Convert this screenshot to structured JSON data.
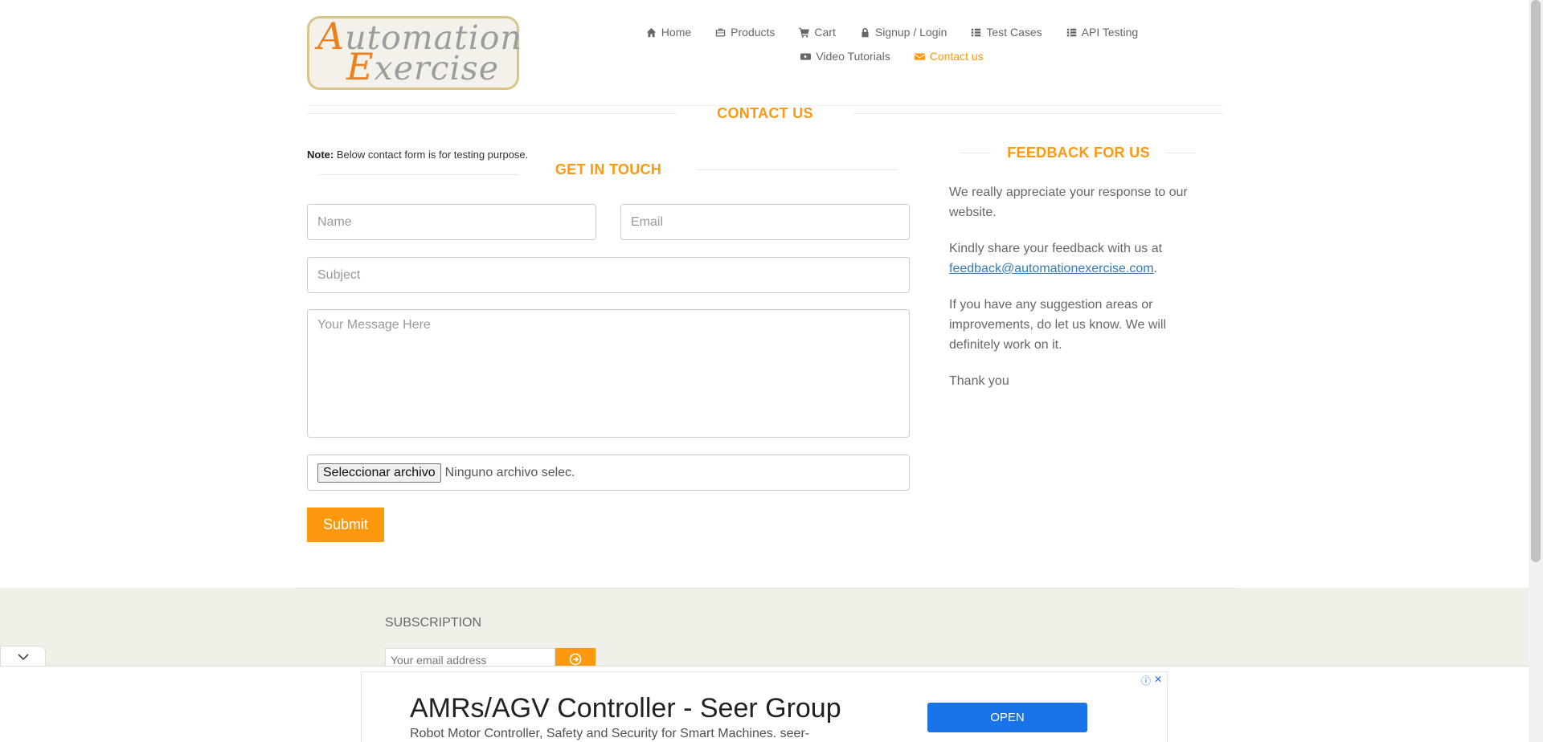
{
  "logo": {
    "line1_cap": "A",
    "line1_rest": "utomation",
    "line2_cap": "E",
    "line2_rest": "xercise"
  },
  "nav": {
    "row1": [
      {
        "label": "Home",
        "icon": "home-icon"
      },
      {
        "label": "Products",
        "icon": "products-icon"
      },
      {
        "label": "Cart",
        "icon": "cart-icon"
      },
      {
        "label": "Signup / Login",
        "icon": "lock-icon"
      },
      {
        "label": "Test Cases",
        "icon": "list-icon"
      },
      {
        "label": "API Testing",
        "icon": "list-icon"
      }
    ],
    "row2": [
      {
        "label": "Video Tutorials",
        "icon": "youtube-icon"
      },
      {
        "label": "Contact us",
        "icon": "envelope-icon",
        "active": true
      }
    ]
  },
  "page_title": "CONTACT US",
  "note": {
    "bold": "Note:",
    "text": " Below contact form is for testing purpose."
  },
  "form": {
    "title": "GET IN TOUCH",
    "name_placeholder": "Name",
    "email_placeholder": "Email",
    "subject_placeholder": "Subject",
    "message_placeholder": "Your Message Here",
    "file_button": "Seleccionar archivo",
    "file_status": "Ninguno archivo selec.",
    "submit_label": "Submit"
  },
  "feedback": {
    "title": "FEEDBACK FOR US",
    "p1": "We really appreciate your response to our website.",
    "p2_prefix": "Kindly share your feedback with us at ",
    "email": "feedback@automationexercise.com",
    "p2_suffix": ".",
    "p3": "If you have any suggestion areas or improvements, do let us know. We will definitely work on it.",
    "p4": "Thank you"
  },
  "footer": {
    "subscription_title": "SUBSCRIPTION",
    "email_placeholder": "Your email address"
  },
  "ad": {
    "title": "AMRs/AGV Controller - Seer Group",
    "description": "Robot Motor Controller, Safety and Security for Smart Machines. seer-",
    "open_label": "OPEN"
  },
  "colors": {
    "accent": "#fe980f",
    "text": "#696763",
    "link": "#337ab7",
    "ad_button": "#1a73e8"
  }
}
